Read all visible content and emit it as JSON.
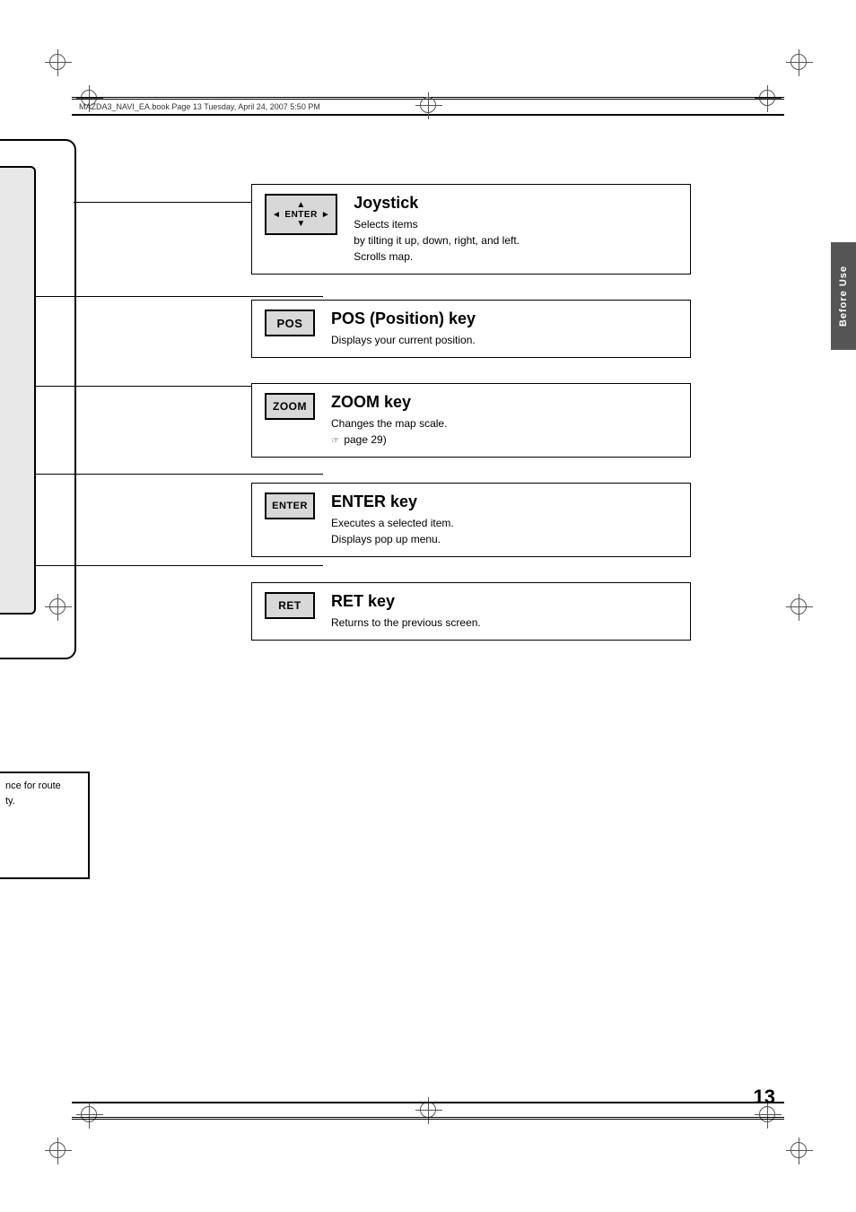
{
  "page": {
    "number": "13",
    "header_text": "MAZDA3_NAVI_EA.book  Page 13  Tuesday, April 24, 2007  5:50 PM"
  },
  "side_tab": {
    "label": "Before Use"
  },
  "keys": [
    {
      "id": "joystick",
      "badge": "ENTER",
      "title": "Joystick",
      "description_lines": [
        "Selects items",
        "by tilting it up, down, right, and left.",
        "Scrolls map."
      ]
    },
    {
      "id": "pos",
      "badge": "POS",
      "title": "POS (Position) key",
      "description_lines": [
        "Displays your current position."
      ]
    },
    {
      "id": "zoom",
      "badge": "ZOOM",
      "title": "ZOOM key",
      "description_lines": [
        "Changes the map scale.",
        "( page 29)"
      ]
    },
    {
      "id": "enter",
      "badge": "ENTER",
      "title": "ENTER key",
      "description_lines": [
        "Executes a selected item.",
        "Displays pop up menu."
      ]
    },
    {
      "id": "ret",
      "badge": "RET",
      "title": "RET key",
      "description_lines": [
        "Returns to the previous screen."
      ]
    }
  ],
  "bottom_left_text": {
    "line1": "nce for route",
    "line2": "ty."
  }
}
